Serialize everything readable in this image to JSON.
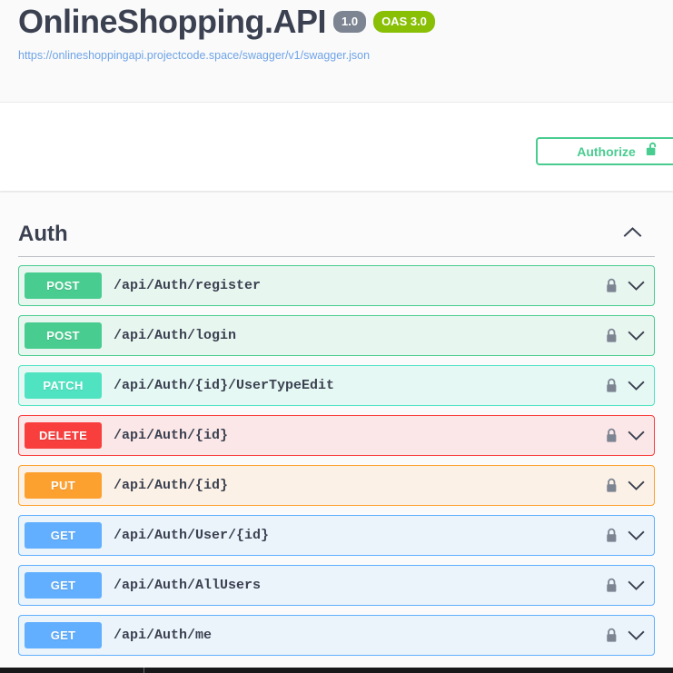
{
  "header": {
    "title": "OnlineShopping.API",
    "version_badge": "1.0",
    "oas_badge": "OAS 3.0",
    "spec_url": "https://onlineshoppingapi.projectcode.space/swagger/v1/swagger.json"
  },
  "authorize": {
    "label": "Authorize",
    "lock_icon": "lock-open-icon",
    "accent_color": "#49cc90"
  },
  "tag": {
    "name": "Auth",
    "collapse_icon": "chevron-up-icon",
    "expanded": true
  },
  "operations": [
    {
      "method": "POST",
      "path": "/api/Auth/register",
      "method_color": "#49cc90",
      "row_bg": "#e8f6f0",
      "lock_icon": "lock-closed-icon",
      "chevron_icon": "chevron-down-icon"
    },
    {
      "method": "POST",
      "path": "/api/Auth/login",
      "method_color": "#49cc90",
      "row_bg": "#e8f6f0",
      "lock_icon": "lock-closed-icon",
      "chevron_icon": "chevron-down-icon"
    },
    {
      "method": "PATCH",
      "path": "/api/Auth/{id}/UserTypeEdit",
      "method_color": "#50e3c2",
      "row_bg": "#e5f8f4",
      "lock_icon": "lock-closed-icon",
      "chevron_icon": "chevron-down-icon"
    },
    {
      "method": "DELETE",
      "path": "/api/Auth/{id}",
      "method_color": "#f93e3e",
      "row_bg": "#fbe7e7",
      "lock_icon": "lock-closed-icon",
      "chevron_icon": "chevron-down-icon"
    },
    {
      "method": "PUT",
      "path": "/api/Auth/{id}",
      "method_color": "#fca130",
      "row_bg": "#fcf1e6",
      "lock_icon": "lock-closed-icon",
      "chevron_icon": "chevron-down-icon"
    },
    {
      "method": "GET",
      "path": "/api/Auth/User/{id}",
      "method_color": "#61affe",
      "row_bg": "#ebf3fb",
      "lock_icon": "lock-closed-icon",
      "chevron_icon": "chevron-down-icon"
    },
    {
      "method": "GET",
      "path": "/api/Auth/AllUsers",
      "method_color": "#61affe",
      "row_bg": "#ebf3fb",
      "lock_icon": "lock-closed-icon",
      "chevron_icon": "chevron-down-icon"
    },
    {
      "method": "GET",
      "path": "/api/Auth/me",
      "method_color": "#61affe",
      "row_bg": "#ebf3fb",
      "lock_icon": "lock-closed-icon",
      "chevron_icon": "chevron-down-icon"
    }
  ]
}
